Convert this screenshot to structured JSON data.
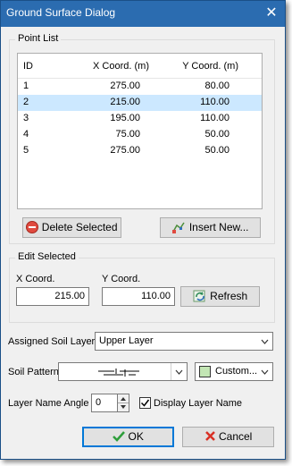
{
  "window": {
    "title": "Ground Surface Dialog"
  },
  "point_list": {
    "group_title": "Point List",
    "columns": [
      "ID",
      "X Coord. (m)",
      "Y Coord. (m)"
    ],
    "rows": [
      {
        "id": "1",
        "x": "275.00",
        "y": "80.00"
      },
      {
        "id": "2",
        "x": "215.00",
        "y": "110.00"
      },
      {
        "id": "3",
        "x": "195.00",
        "y": "110.00"
      },
      {
        "id": "4",
        "x": "75.00",
        "y": "50.00"
      },
      {
        "id": "5",
        "x": "275.00",
        "y": "50.00"
      }
    ],
    "delete_label": "Delete Selected",
    "insert_label": "Insert New..."
  },
  "edit_selected": {
    "group_title": "Edit Selected",
    "x_label": "X Coord.",
    "y_label": "Y Coord.",
    "x_value": "215.00",
    "y_value": "110.00",
    "refresh_label": "Refresh"
  },
  "soil": {
    "layer_label": "Assigned Soil Layer",
    "layer_value": "Upper Layer",
    "pattern_label": "Soil Pattern",
    "color_label": "Custom...",
    "color_value": "#c3e6b4"
  },
  "name": {
    "angle_label": "Layer Name Angle",
    "angle_value": "0",
    "display_label": "Display Layer Name",
    "display_checked": true
  },
  "actions": {
    "ok_label": "OK",
    "cancel_label": "Cancel"
  }
}
